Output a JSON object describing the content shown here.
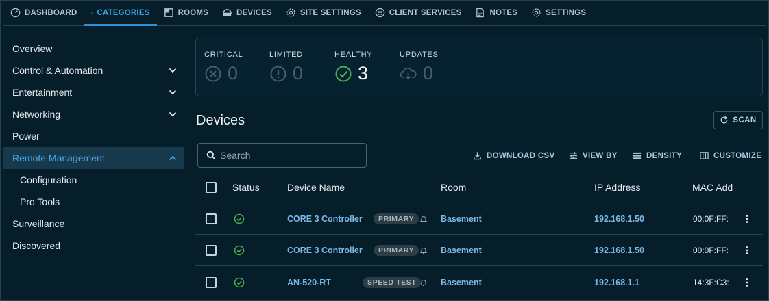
{
  "nav": {
    "tabs": [
      {
        "label": "DASHBOARD",
        "icon": "dashboard-icon"
      },
      {
        "label": "CATEGORIES",
        "icon": "categories-icon",
        "active": true
      },
      {
        "label": "ROOMS",
        "icon": "rooms-icon"
      },
      {
        "label": "DEVICES",
        "icon": "devices-icon"
      },
      {
        "label": "SITE SETTINGS",
        "icon": "gear-icon"
      },
      {
        "label": "CLIENT SERVICES",
        "icon": "client-services-icon"
      },
      {
        "label": "NOTES",
        "icon": "notes-icon"
      },
      {
        "label": "SETTINGS",
        "icon": "gear-icon"
      }
    ]
  },
  "sidebar": {
    "items": [
      {
        "label": "Overview"
      },
      {
        "label": "Control & Automation",
        "chevron": "down"
      },
      {
        "label": "Entertainment",
        "chevron": "down"
      },
      {
        "label": "Networking",
        "chevron": "down"
      },
      {
        "label": "Power"
      },
      {
        "label": "Remote Management",
        "chevron": "up",
        "active": true
      },
      {
        "label": "Configuration",
        "sub": true
      },
      {
        "label": "Pro Tools",
        "sub": true
      },
      {
        "label": "Surveillance"
      },
      {
        "label": "Discovered"
      }
    ]
  },
  "status": {
    "critical": {
      "label": "CRITICAL",
      "value": "0"
    },
    "limited": {
      "label": "LIMITED",
      "value": "0"
    },
    "healthy": {
      "label": "HEALTHY",
      "value": "3"
    },
    "updates": {
      "label": "UPDATES",
      "value": "0"
    }
  },
  "devices": {
    "title": "Devices",
    "scan_label": "SCAN",
    "search_placeholder": "Search",
    "toolbar": {
      "download_csv": "DOWNLOAD CSV",
      "view_by": "VIEW BY",
      "density": "DENSITY",
      "customize": "CUSTOMIZE"
    },
    "columns": {
      "status": "Status",
      "device_name": "Device Name",
      "room": "Room",
      "ip": "IP Address",
      "mac": "MAC Add"
    },
    "rows": [
      {
        "name": "CORE 3 Controller",
        "badge": "PRIMARY",
        "room": "Basement",
        "ip": "192.168.1.50",
        "mac": "00:0F:FF:"
      },
      {
        "name": "CORE 3 Controller",
        "badge": "PRIMARY",
        "room": "Basement",
        "ip": "192.168.1.50",
        "mac": "00:0F:FF:"
      },
      {
        "name": "AN-520-RT",
        "badge": "SPEED TEST",
        "room": "Basement",
        "ip": "192.168.1.1",
        "mac": "14:3F:C3:"
      }
    ]
  },
  "colors": {
    "background": "#061d2a",
    "accent": "#2d8fd6",
    "healthy": "#4caf50",
    "muted": "#4d5f68"
  }
}
